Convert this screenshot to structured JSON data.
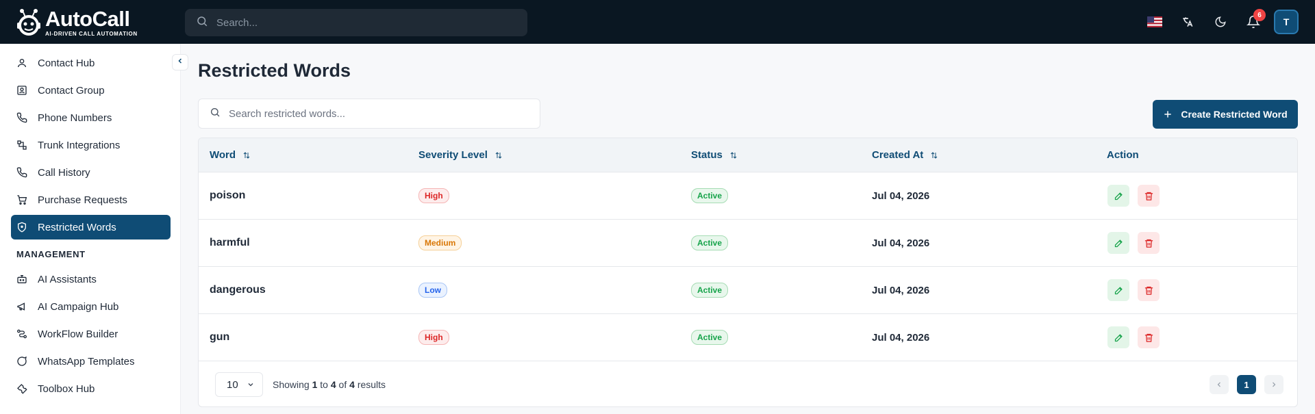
{
  "app": {
    "logo_title": "AutoCall",
    "logo_subtitle": "AI-DRIVEN CALL AUTOMATION"
  },
  "header": {
    "search_placeholder": "Search...",
    "notification_count": "6",
    "avatar_initial": "T",
    "icons": [
      "us-flag-icon",
      "translate-icon",
      "moon-icon",
      "bell-icon"
    ]
  },
  "sidebar": {
    "items": [
      {
        "label": "Contact Hub",
        "icon": "user-icon"
      },
      {
        "label": "Contact Group",
        "icon": "contact-card-icon"
      },
      {
        "label": "Phone Numbers",
        "icon": "phone-icon"
      },
      {
        "label": "Trunk Integrations",
        "icon": "network-icon"
      },
      {
        "label": "Call History",
        "icon": "phone-icon"
      },
      {
        "label": "Purchase Requests",
        "icon": "cart-icon"
      },
      {
        "label": "Restricted Words",
        "icon": "shield-icon",
        "active": true
      }
    ],
    "section_label": "MANAGEMENT",
    "management_items": [
      {
        "label": "AI Assistants",
        "icon": "bot-icon"
      },
      {
        "label": "AI Campaign Hub",
        "icon": "megaphone-icon"
      },
      {
        "label": "WorkFlow Builder",
        "icon": "workflow-icon"
      },
      {
        "label": "WhatsApp Templates",
        "icon": "chat-icon"
      },
      {
        "label": "Toolbox Hub",
        "icon": "wrench-icon"
      }
    ]
  },
  "main": {
    "title": "Restricted Words",
    "search_placeholder": "Search restricted words...",
    "create_button": "Create Restricted Word",
    "table": {
      "columns": [
        "Word",
        "Severity Level",
        "Status",
        "Created At",
        "Action"
      ],
      "rows": [
        {
          "word": "poison",
          "severity": "High",
          "status": "Active",
          "created_at": "Jul 04, 2026"
        },
        {
          "word": "harmful",
          "severity": "Medium",
          "status": "Active",
          "created_at": "Jul 04, 2026"
        },
        {
          "word": "dangerous",
          "severity": "Low",
          "status": "Active",
          "created_at": "Jul 04, 2026"
        },
        {
          "word": "gun",
          "severity": "High",
          "status": "Active",
          "created_at": "Jul 04, 2026"
        }
      ]
    },
    "pagination": {
      "per_page": "10",
      "showing_prefix": "Showing",
      "from": "1",
      "to_word": "to",
      "to": "4",
      "of_word": "of",
      "total": "4",
      "results_word": "results",
      "current_page": "1"
    }
  },
  "colors": {
    "header_bg": "#0a1722",
    "brand": "#0f4c75",
    "high": "#dc2626",
    "medium": "#d97706",
    "low": "#2563eb",
    "active": "#16a34a"
  }
}
